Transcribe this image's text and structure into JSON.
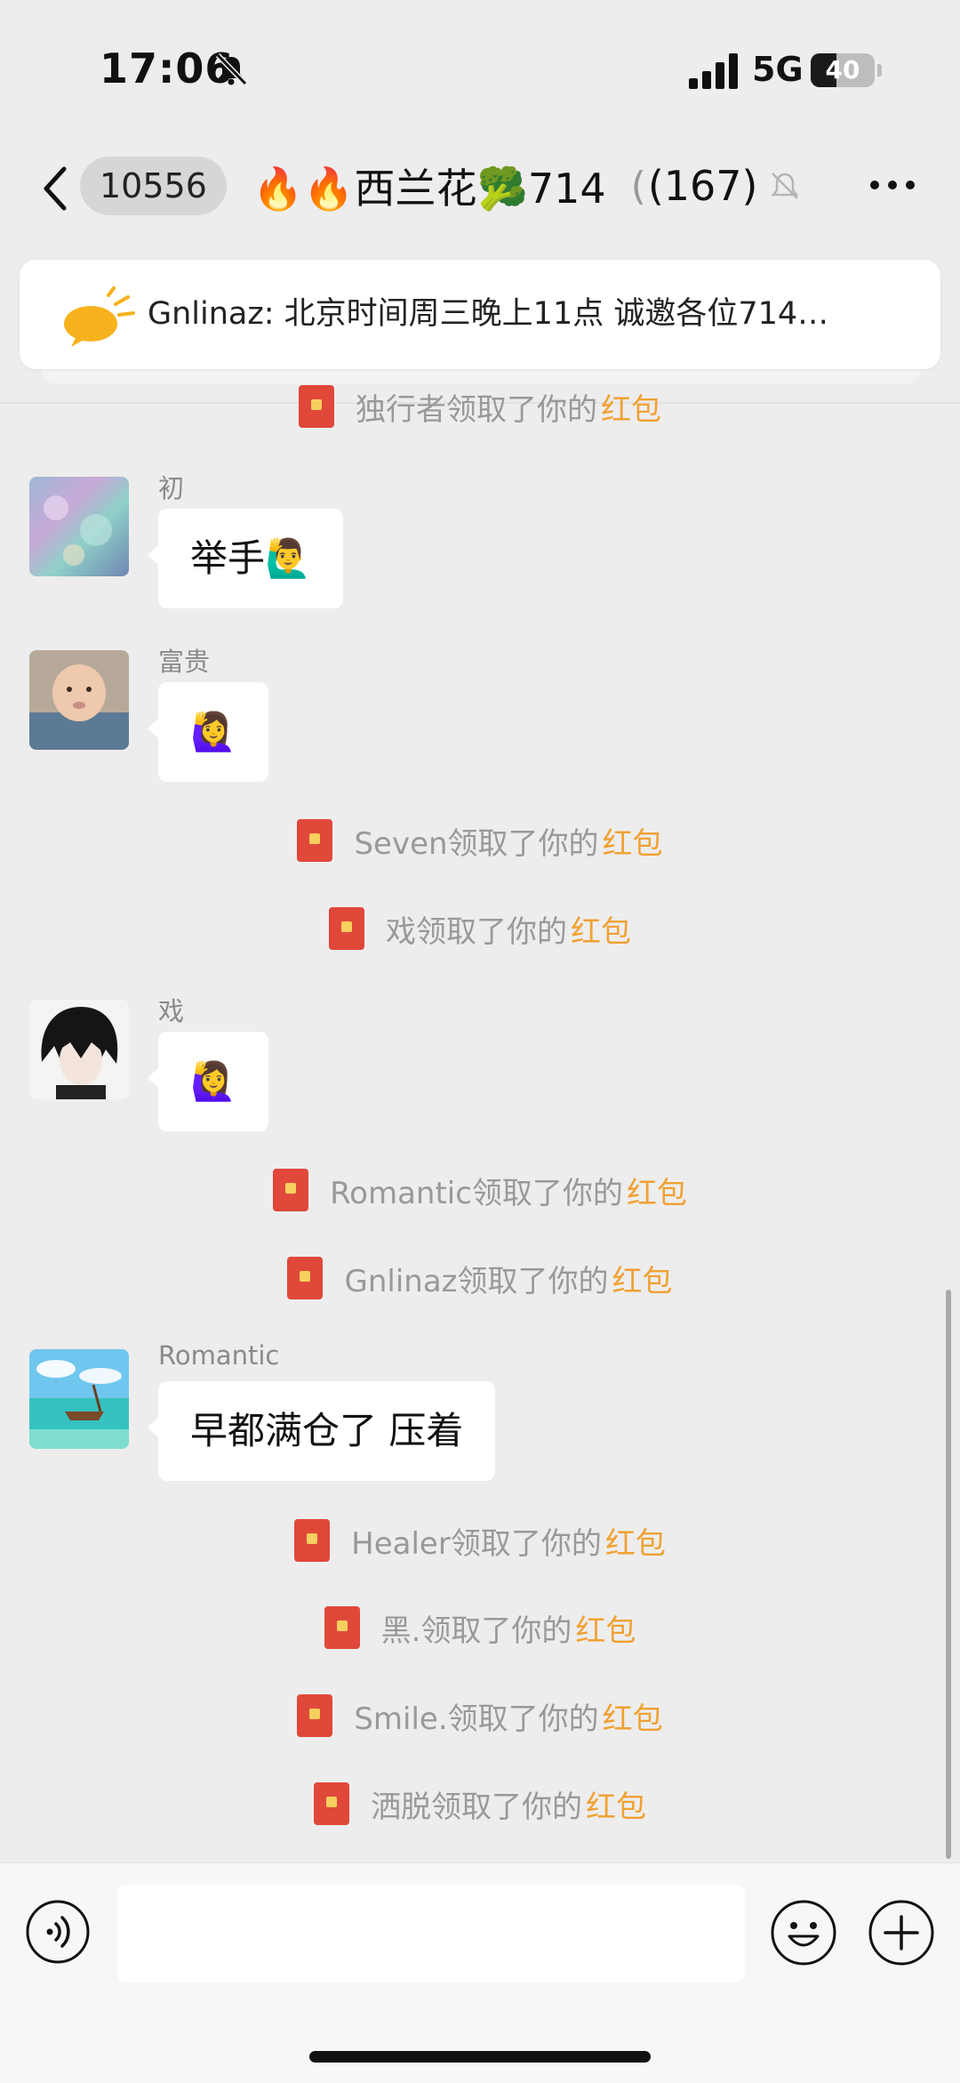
{
  "status_bar": {
    "time": "17:06",
    "network": "5G",
    "battery": "40",
    "battery_level": 0.4
  },
  "nav": {
    "unread_count": "10556",
    "title": "🔥🔥西兰花🥦714",
    "paren": "(",
    "member_count": "(167)"
  },
  "announcement": {
    "text": "Gnlinaz: 北京时间周三晚上11点   诚邀各位714…"
  },
  "messages": [
    {
      "type": "system",
      "text": "独行者领取了你的",
      "link": "红包"
    },
    {
      "type": "chat",
      "sender": "初",
      "text": "举手🙋‍♂️",
      "avatar": "opal-avatar"
    },
    {
      "type": "chat",
      "sender": "富贵",
      "text": "🙋‍♀️",
      "avatar": "baby-avatar"
    },
    {
      "type": "system",
      "text": "Seven领取了你的",
      "link": "红包"
    },
    {
      "type": "system",
      "text": "戏领取了你的",
      "link": "红包"
    },
    {
      "type": "chat",
      "sender": "戏",
      "text": "🙋‍♀️",
      "avatar": "anime-avatar"
    },
    {
      "type": "system",
      "text": "Romantic领取了你的",
      "link": "红包"
    },
    {
      "type": "system",
      "text": "Gnlinaz领取了你的",
      "link": "红包"
    },
    {
      "type": "chat",
      "sender": "Romantic",
      "text": "早都满仓了 压着",
      "avatar": "boat-avatar"
    },
    {
      "type": "system",
      "text": "Healer领取了你的",
      "link": "红包"
    },
    {
      "type": "system",
      "text": "黑.领取了你的",
      "link": "红包"
    },
    {
      "type": "system",
      "text": "Smile.领取了你的",
      "link": "红包"
    },
    {
      "type": "system",
      "text": "洒脱领取了你的",
      "link": "红包"
    }
  ],
  "input": {
    "value": ""
  },
  "colors": {
    "background": "#ededed",
    "red_packet_link": "#f0a133",
    "red_packet_icon": "#e0483a"
  }
}
